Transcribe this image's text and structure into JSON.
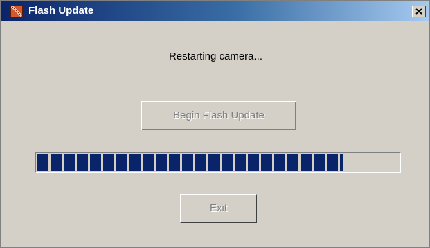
{
  "window": {
    "title": "Flash Update",
    "icon": "flash-app-icon",
    "close_glyph": "✕"
  },
  "status": {
    "message": "Restarting camera..."
  },
  "buttons": {
    "begin_label": "Begin Flash Update",
    "begin_enabled": false,
    "exit_label": "Exit",
    "exit_enabled": false
  },
  "progress": {
    "fraction": 0.845,
    "color": "#0a246a"
  }
}
